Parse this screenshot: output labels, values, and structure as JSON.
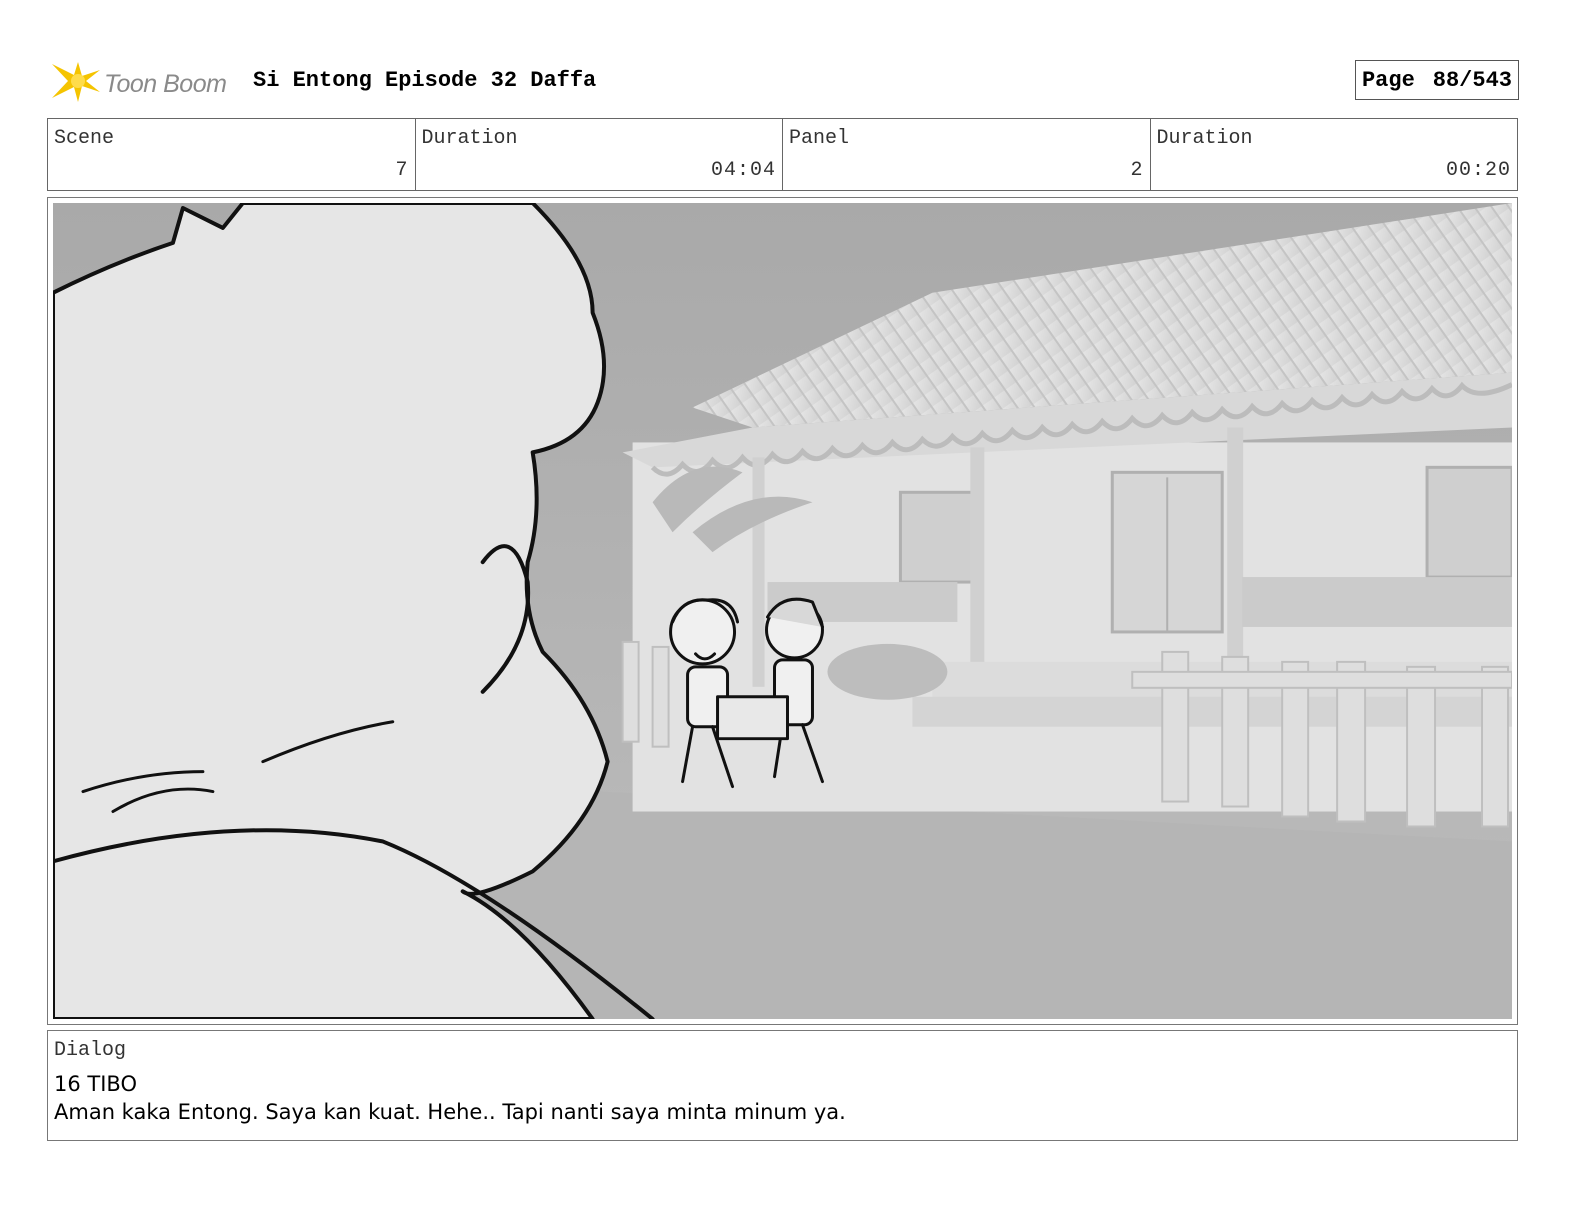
{
  "header": {
    "logo_text": "Toon Boom",
    "project_title": "Si Entong Episode 32 Daffa",
    "page_label": "Page",
    "page_value": "88/543"
  },
  "info": {
    "scene_label": "Scene",
    "scene_value": "7",
    "scene_duration_label": "Duration",
    "scene_duration_value": "04:04",
    "panel_label": "Panel",
    "panel_value": "2",
    "panel_duration_label": "Duration",
    "panel_duration_value": "00:20"
  },
  "dialog": {
    "label": "Dialog",
    "speaker": "16 TIBO",
    "line": "Aman kaka Entong. Saya kan kuat. Hehe.. Tapi nanti saya minta minum ya."
  },
  "colors": {
    "logo_accent": "#f5c400",
    "logo_text": "#8a8a8a"
  }
}
